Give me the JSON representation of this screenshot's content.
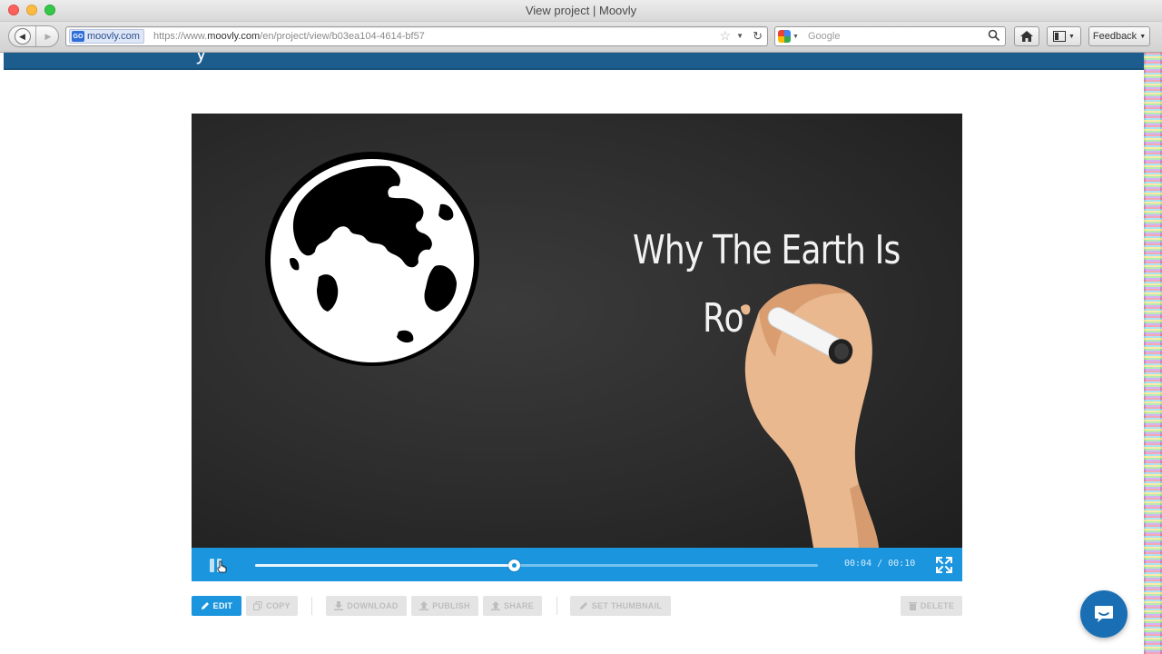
{
  "window": {
    "title": "View project | Moovly"
  },
  "toolbar": {
    "site_badge": "moovly.com",
    "favicon_text": "GO",
    "url_prefix": "https://www.",
    "url_domain": "moovly.com",
    "url_path": "/en/project/view/b03ea104-4614-bf57",
    "search_placeholder": "Google",
    "feedback_label": "Feedback"
  },
  "page": {
    "header_cut_text": "y"
  },
  "player": {
    "title_line1": "Why The Earth Is",
    "title_line2": "Ro",
    "time_readout": "00:04 / 00:10",
    "progress_fraction": 0.46
  },
  "actions": {
    "edit": "EDIT",
    "copy": "COPY",
    "download": "DOWNLOAD",
    "publish": "PUBLISH",
    "share": "SHARE",
    "set_thumbnail": "SET THUMBNAIL",
    "delete": "DELETE"
  },
  "colors": {
    "accent": "#1a95de",
    "header": "#1c5d8e",
    "chat": "#1a6fb4"
  },
  "icons": {
    "back": "back-arrow-icon",
    "forward": "forward-arrow-icon",
    "bookmark": "star-icon",
    "reload": "reload-icon",
    "search": "magnifier-icon",
    "home": "home-icon",
    "sidebar": "sidebar-icon",
    "pause": "pause-icon",
    "fullscreen": "fullscreen-icon",
    "chat": "chat-icon"
  }
}
